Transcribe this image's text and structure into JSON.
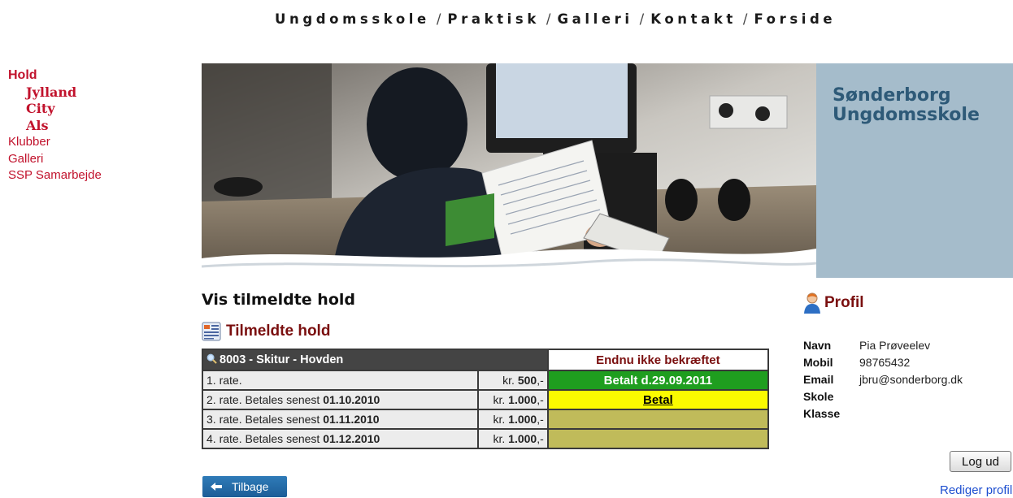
{
  "top_nav": {
    "items": [
      "Ungdomsskole",
      "Praktisk",
      "Galleri",
      "Kontakt",
      "Forside"
    ],
    "separator": "/"
  },
  "side_nav": {
    "hold": "Hold",
    "jylland": "Jylland",
    "city": "City",
    "als": "Als",
    "klubber": "Klubber",
    "galleri": "Galleri",
    "ssp": "SSP Samarbejde"
  },
  "banner": {
    "brand_line1": "Sønderborg",
    "brand_line2": "Ungdomsskole"
  },
  "page": {
    "title": "Vis tilmeldte hold",
    "section_title": "Tilmeldte hold"
  },
  "team": {
    "name": "8003 - Skitur - Hovden",
    "status": "Endnu ikke bekræftet",
    "rows": [
      {
        "label": "1. rate.",
        "due_prefix": "",
        "due_date": "",
        "currency": "kr. ",
        "amount": "500",
        "suffix": ",-",
        "status": "Betalt d.29.09.2011",
        "status_type": "paid"
      },
      {
        "label": "2. rate.",
        "due_prefix": " Betales senest ",
        "due_date": "01.10.2010",
        "currency": "kr. ",
        "amount": "1.000",
        "suffix": ",-",
        "status": "Betal",
        "status_type": "pay"
      },
      {
        "label": "3. rate.",
        "due_prefix": " Betales senest ",
        "due_date": "01.11.2010",
        "currency": "kr. ",
        "amount": "1.000",
        "suffix": ",-",
        "status": "",
        "status_type": "pending"
      },
      {
        "label": "4. rate.",
        "due_prefix": " Betales senest ",
        "due_date": "01.12.2010",
        "currency": "kr. ",
        "amount": "1.000",
        "suffix": ",-",
        "status": "",
        "status_type": "pending"
      }
    ]
  },
  "back_button": {
    "label": "Tilbage"
  },
  "profile": {
    "title": "Profil",
    "fields": [
      {
        "key": "Navn",
        "value": "Pia Prøveelev"
      },
      {
        "key": "Mobil",
        "value": "98765432"
      },
      {
        "key": "Email",
        "value": "jbru@sonderborg.dk"
      },
      {
        "key": "Skole",
        "value": ""
      },
      {
        "key": "Klasse",
        "value": ""
      }
    ],
    "logout_label": "Log ud",
    "edit_label": "Rediger profil"
  },
  "colors": {
    "nav_red": "#c1122c",
    "title_maroon": "#7a0f0f",
    "paid_green": "#1f9e1f",
    "pay_yellow": "#fbfb00",
    "pending_olive": "#c0bb5a",
    "brand_panel": "#a5bccb",
    "brand_text": "#2e5a78"
  }
}
